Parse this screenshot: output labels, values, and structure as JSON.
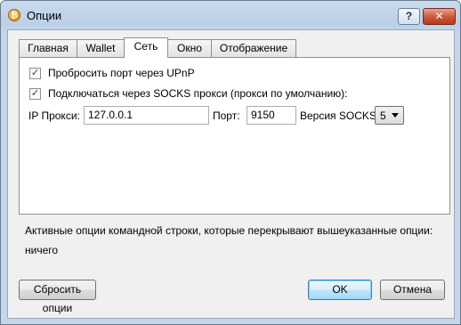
{
  "window": {
    "title": "Опции",
    "icon": "bitcoin-icon",
    "icon_glyph": "₿",
    "help_glyph": "?",
    "close_glyph": "✕"
  },
  "tabs": [
    {
      "label": "Главная",
      "active": false
    },
    {
      "label": "Wallet",
      "active": false
    },
    {
      "label": "Сеть",
      "active": true
    },
    {
      "label": "Окно",
      "active": false
    },
    {
      "label": "Отображение",
      "active": false
    }
  ],
  "network": {
    "upnp": {
      "label": "Пробросить порт через UPnP",
      "checked": true
    },
    "socks": {
      "label": "Подключаться через SOCKS прокси (прокси по умолчанию):",
      "checked": true
    },
    "proxy_ip_label": "IP Прокси:",
    "proxy_ip_value": "127.0.0.1",
    "port_label": "Порт:",
    "port_value": "9150",
    "socks_version_label": "Версия SOCKS:",
    "socks_version_value": "5"
  },
  "cmdline": {
    "heading": "Активные опции командной строки, которые перекрывают вышеуказанные опции:",
    "value": "ничего"
  },
  "buttons": {
    "reset": "Сбросить опции",
    "ok": "OK",
    "cancel": "Отмена"
  },
  "check_glyph": "✓"
}
